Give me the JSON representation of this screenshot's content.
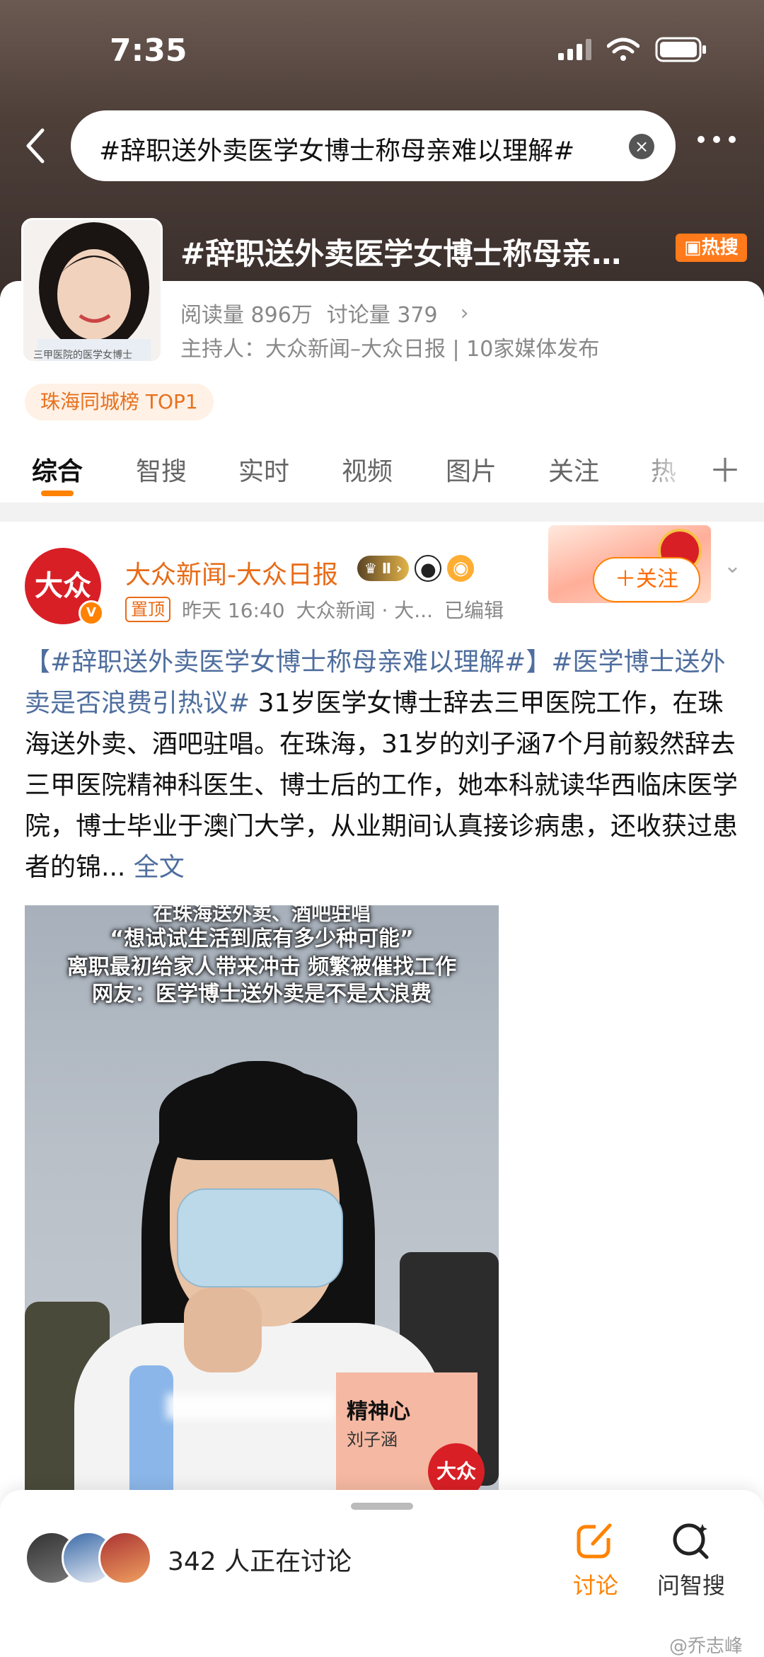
{
  "status_bar": {
    "time": "7:35"
  },
  "search": {
    "query": "#辞职送外卖医学女博士称母亲难以理解#"
  },
  "topic": {
    "title": "#辞职送外卖医学女博士称母亲难以理解#",
    "hot_badge": "热搜",
    "stats": {
      "reads": "阅读量 896万",
      "discussions": "讨论量 379"
    },
    "host": "主持人：大众新闻–大众日报 | 10家媒体发布",
    "rank_tag": "珠海同城榜 TOP1",
    "thumb_caption": "三甲医院的医学女博士"
  },
  "tabs": [
    "综合",
    "智搜",
    "实时",
    "视频",
    "图片",
    "关注",
    "热"
  ],
  "active_tab": "综合",
  "post": {
    "author": "大众新闻-大众日报",
    "avatar_text": "大众",
    "level": "Ⅱ",
    "pinned": "置顶",
    "time": "昨天 16:40",
    "source": "大众新闻 · 大...",
    "edited": "已编辑",
    "follow_label": "＋关注",
    "hashtag1": "【#辞职送外卖医学女博士称母亲难以理解#】",
    "hashtag2": "#医学博士送外卖是否浪费引热议#",
    "body": " 31岁医学女博士辞去三甲医院工作，在珠海送外卖、酒吧驻唱。在珠海，31岁的刘子涵7个月前毅然辞去三甲医院精神科医生、博士后的工作，她本科就读华西临床医学院，博士毕业于澳门大学，从业期间认真接诊病患，还收获过患者的锦...",
    "full_text": "全文",
    "image_captions": [
      "在珠海送外卖、酒吧驻唱",
      "“想试试生活到底有多少种可能”",
      "离职最初给家人带来冲击 频繁被催找工作",
      "网友：医学博士送外卖是不是太浪费"
    ],
    "name_card": "精神心",
    "name_card_sub": "刘子涵"
  },
  "bottom": {
    "discussing": "342 人正在讨论",
    "discuss_label": "讨论",
    "ask_label": "问智搜"
  },
  "watermark": "@乔志峰",
  "colors": {
    "accent": "#ff8200",
    "link": "#4f6e9e",
    "author": "#e86b17"
  }
}
